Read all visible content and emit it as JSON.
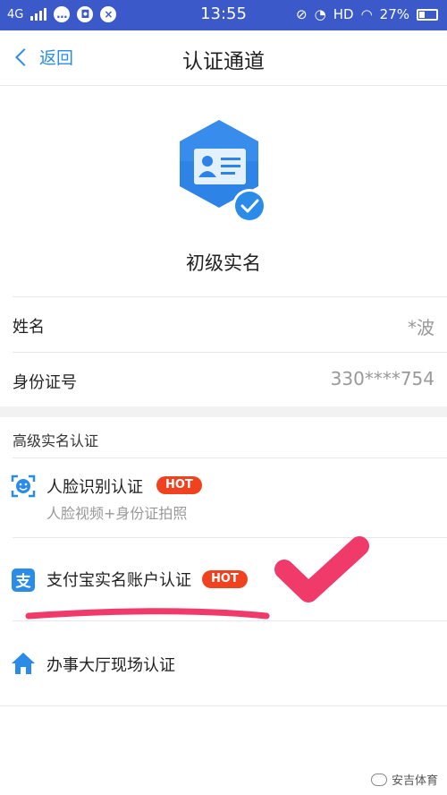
{
  "status_bar": {
    "network": "4G",
    "time": "13:55",
    "hd": "HD",
    "battery": "27%"
  },
  "nav": {
    "back_label": "返回",
    "title": "认证通道"
  },
  "badge": {
    "title": "初级实名",
    "colors": {
      "hex": "#2e83e6",
      "check": "#2a8be8"
    }
  },
  "info_rows": [
    {
      "label": "姓名",
      "value": "*波"
    },
    {
      "label": "身份证号",
      "value": "330****754"
    }
  ],
  "advanced": {
    "title": "高级实名认证",
    "options": [
      {
        "label": "人脸识别认证",
        "sub": "人脸视频+身份证拍照",
        "badge": "HOT",
        "icon": "face-scan-icon"
      },
      {
        "label": "支付宝实名账户认证",
        "badge": "HOT",
        "icon": "alipay-icon"
      },
      {
        "label": "办事大厅现场认证",
        "icon": "home-icon"
      }
    ]
  },
  "watermark": "安吉体育",
  "colors": {
    "status_bar": "#3b59c9",
    "accent": "#2a8be8",
    "hot": "#f0421f",
    "annotation": "#f03a6a"
  }
}
